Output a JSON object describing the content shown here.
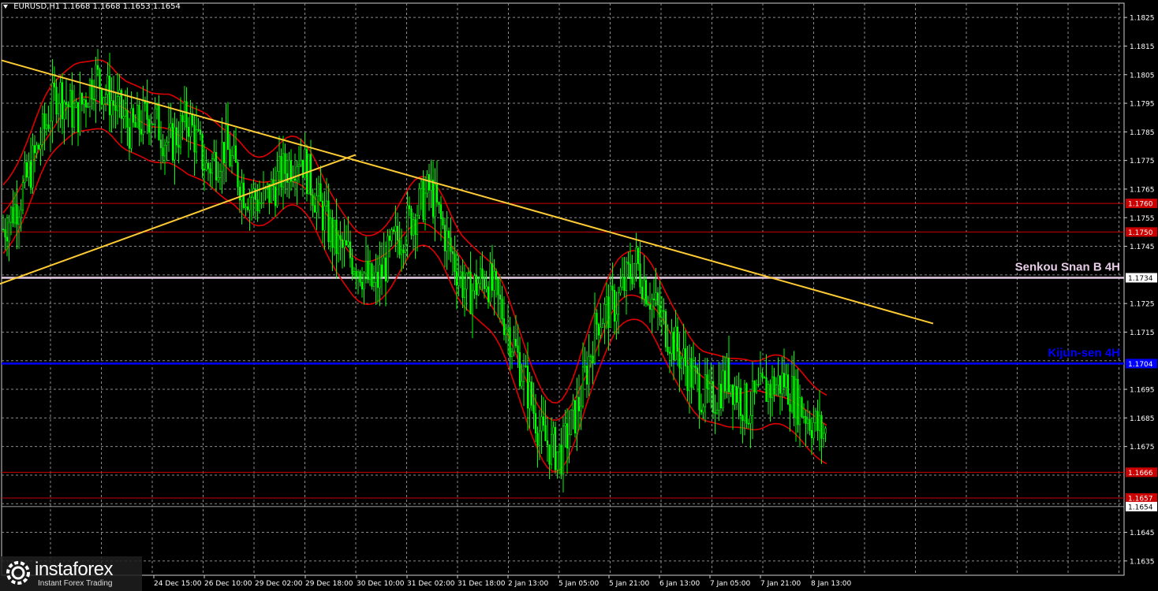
{
  "header": {
    "symbol": "EURUSD,H1",
    "ohlc": "1.1668 1.1668 1.1653 1.1654"
  },
  "logo": {
    "brand": "instaforex",
    "tagline": "Instant Forex Trading"
  },
  "colors": {
    "background": "#000000",
    "grid": "#8a8a8a",
    "candles": "#00ff00",
    "ichimoku": "#e00000",
    "trendline": "#ffcc33",
    "senkou_b": "#e6cce6",
    "kijun": "#0000ff",
    "level": "#cc0000"
  },
  "chart_data": {
    "type": "line",
    "symbol": "EURUSD",
    "timeframe": "H1",
    "ylim": [
      1.163,
      1.183
    ],
    "y_ticks": [
      "1.1825",
      "1.1815",
      "1.1805",
      "1.1795",
      "1.1785",
      "1.1775",
      "1.1765",
      "1.1755",
      "1.1745",
      "1.1725",
      "1.1715",
      "1.1695",
      "1.1685",
      "1.1675",
      "1.1645",
      "1.1635"
    ],
    "x_ticks": [
      "24 Dec 15:00",
      "26 Dec 10:00",
      "29 Dec 02:00",
      "29 Dec 18:00",
      "30 Dec 10:00",
      "31 Dec 02:00",
      "31 Dec 18:00",
      "2 Jan 13:00",
      "5 Jan 05:00",
      "5 Jan 21:00",
      "6 Jan 13:00",
      "7 Jan 05:00",
      "7 Jan 21:00",
      "8 Jan 13:00"
    ],
    "price_levels": [
      {
        "value": 1.176,
        "label": "1.1760",
        "kind": "support_resistance"
      },
      {
        "value": 1.175,
        "label": "1.1750",
        "kind": "support_resistance"
      },
      {
        "value": 1.1734,
        "label": "1.1734",
        "kind": "senkou_span_b",
        "annotation": "Senkou Snan B 4H"
      },
      {
        "value": 1.1704,
        "label": "1.1704",
        "kind": "kijun_sen",
        "annotation": "Kijun-sen 4H"
      },
      {
        "value": 1.1666,
        "label": "1.1666",
        "kind": "support_resistance"
      },
      {
        "value": 1.1657,
        "label": "1.1657",
        "kind": "support_resistance"
      }
    ],
    "current_price": {
      "value": 1.1654,
      "label": "1.1654"
    },
    "trendlines": [
      {
        "name": "descending",
        "from": [
          0.0,
          1.181
        ],
        "to": [
          1.0,
          1.1718
        ]
      },
      {
        "name": "ascending",
        "from": [
          -0.17,
          1.1712
        ],
        "to": [
          0.38,
          1.1777
        ]
      }
    ],
    "series": [
      {
        "name": "price",
        "x": [
          0.0,
          0.02,
          0.04,
          0.06,
          0.08,
          0.1,
          0.12,
          0.14,
          0.16,
          0.18,
          0.2,
          0.22,
          0.24,
          0.26,
          0.28,
          0.3,
          0.32,
          0.34,
          0.36,
          0.38,
          0.4,
          0.42,
          0.44,
          0.46,
          0.48,
          0.5,
          0.52,
          0.54,
          0.56,
          0.58,
          0.6,
          0.62,
          0.64,
          0.66,
          0.68,
          0.7,
          0.72,
          0.74,
          0.76,
          0.78,
          0.8,
          0.82,
          0.84,
          0.86,
          0.88,
          0.9,
          0.92,
          0.94
        ],
        "y": [
          1.175,
          1.1762,
          1.178,
          1.18,
          1.179,
          1.1805,
          1.1795,
          1.1785,
          1.1792,
          1.178,
          1.179,
          1.1772,
          1.178,
          1.1765,
          1.176,
          1.177,
          1.1778,
          1.176,
          1.1745,
          1.174,
          1.173,
          1.1745,
          1.1755,
          1.1765,
          1.1745,
          1.1728,
          1.1735,
          1.172,
          1.17,
          1.1678,
          1.1672,
          1.169,
          1.172,
          1.1725,
          1.174,
          1.1725,
          1.1712,
          1.17,
          1.169,
          1.17,
          1.1688,
          1.1695,
          1.1698,
          1.1688,
          1.168,
          1.1678,
          1.1672,
          1.1655
        ]
      }
    ]
  }
}
